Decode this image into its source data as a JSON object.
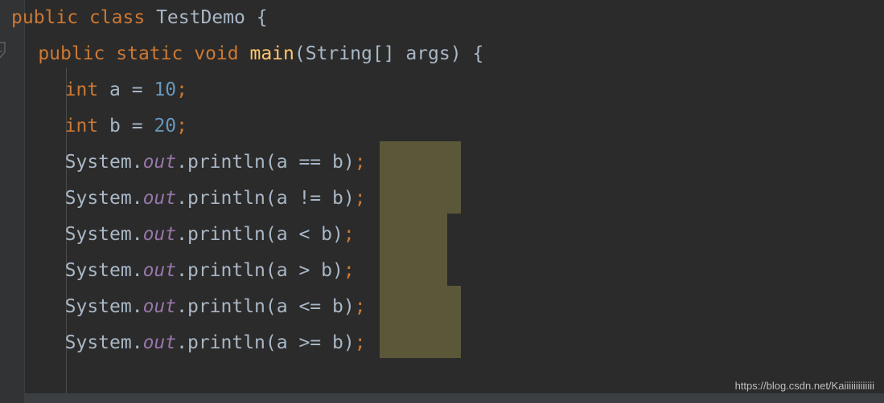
{
  "editor": {
    "theme_name": "darcula",
    "background_color": "#2b2b2b",
    "gutter_color": "#313335",
    "selection_color": "#5b5739",
    "default_text_color": "#a9b7c6",
    "keyword_color": "#cc7832",
    "number_color": "#6897bb",
    "method_color": "#ffc66d",
    "static_field_color": "#9876aa",
    "fold_marker": "code-fold-collapse-arrow"
  },
  "code": {
    "language": "Java",
    "class_name": "TestDemo",
    "lines": [
      {
        "indent": 0,
        "text": "public class TestDemo {",
        "tokens": [
          {
            "t": "public",
            "c": "kw"
          },
          {
            "t": " ",
            "c": "punc"
          },
          {
            "t": "class",
            "c": "kw"
          },
          {
            "t": " ",
            "c": "punc"
          },
          {
            "t": "TestDemo",
            "c": "typ"
          },
          {
            "t": " {",
            "c": "punc"
          }
        ]
      },
      {
        "indent": 1,
        "text": "public static void main(String[] args) {",
        "tokens": [
          {
            "t": "public",
            "c": "kw"
          },
          {
            "t": " ",
            "c": "punc"
          },
          {
            "t": "static",
            "c": "kw"
          },
          {
            "t": " ",
            "c": "punc"
          },
          {
            "t": "void",
            "c": "kw"
          },
          {
            "t": " ",
            "c": "punc"
          },
          {
            "t": "main",
            "c": "fn"
          },
          {
            "t": "(",
            "c": "punc"
          },
          {
            "t": "String",
            "c": "typ"
          },
          {
            "t": "[] ",
            "c": "punc"
          },
          {
            "t": "args",
            "c": "id"
          },
          {
            "t": ") {",
            "c": "punc"
          }
        ]
      },
      {
        "indent": 2,
        "text": "int a = 10;",
        "tokens": [
          {
            "t": "int",
            "c": "kw"
          },
          {
            "t": " ",
            "c": "punc"
          },
          {
            "t": "a",
            "c": "id"
          },
          {
            "t": " = ",
            "c": "punc"
          },
          {
            "t": "10",
            "c": "num"
          },
          {
            "t": ";",
            "c": "semi"
          }
        ]
      },
      {
        "indent": 2,
        "text": "int b = 20;",
        "tokens": [
          {
            "t": "int",
            "c": "kw"
          },
          {
            "t": " ",
            "c": "punc"
          },
          {
            "t": "b",
            "c": "id"
          },
          {
            "t": " = ",
            "c": "punc"
          },
          {
            "t": "20",
            "c": "num"
          },
          {
            "t": ";",
            "c": "semi"
          }
        ]
      },
      {
        "indent": 2,
        "text": "System.out.println(a == b);",
        "selection": "a == b",
        "tokens": [
          {
            "t": "System",
            "c": "typ"
          },
          {
            "t": ".",
            "c": "punc"
          },
          {
            "t": "out",
            "c": "stat"
          },
          {
            "t": ".println(",
            "c": "punc"
          },
          {
            "t": "a",
            "c": "id"
          },
          {
            "t": " == ",
            "c": "punc"
          },
          {
            "t": "b",
            "c": "id"
          },
          {
            "t": ")",
            "c": "punc"
          },
          {
            "t": ";",
            "c": "semi"
          }
        ]
      },
      {
        "indent": 2,
        "text": "System.out.println(a != b);",
        "selection": "a != b",
        "tokens": [
          {
            "t": "System",
            "c": "typ"
          },
          {
            "t": ".",
            "c": "punc"
          },
          {
            "t": "out",
            "c": "stat"
          },
          {
            "t": ".println(",
            "c": "punc"
          },
          {
            "t": "a",
            "c": "id"
          },
          {
            "t": " != ",
            "c": "punc"
          },
          {
            "t": "b",
            "c": "id"
          },
          {
            "t": ")",
            "c": "punc"
          },
          {
            "t": ";",
            "c": "semi"
          }
        ]
      },
      {
        "indent": 2,
        "text": "System.out.println(a < b);",
        "selection": "a < b",
        "tokens": [
          {
            "t": "System",
            "c": "typ"
          },
          {
            "t": ".",
            "c": "punc"
          },
          {
            "t": "out",
            "c": "stat"
          },
          {
            "t": ".println(",
            "c": "punc"
          },
          {
            "t": "a",
            "c": "id"
          },
          {
            "t": " < ",
            "c": "punc"
          },
          {
            "t": "b",
            "c": "id"
          },
          {
            "t": ")",
            "c": "punc"
          },
          {
            "t": ";",
            "c": "semi"
          }
        ]
      },
      {
        "indent": 2,
        "text": "System.out.println(a > b);",
        "selection": "a > b",
        "tokens": [
          {
            "t": "System",
            "c": "typ"
          },
          {
            "t": ".",
            "c": "punc"
          },
          {
            "t": "out",
            "c": "stat"
          },
          {
            "t": ".println(",
            "c": "punc"
          },
          {
            "t": "a",
            "c": "id"
          },
          {
            "t": " > ",
            "c": "punc"
          },
          {
            "t": "b",
            "c": "id"
          },
          {
            "t": ")",
            "c": "punc"
          },
          {
            "t": ";",
            "c": "semi"
          }
        ]
      },
      {
        "indent": 2,
        "text": "System.out.println(a <= b);",
        "selection": "a <= b",
        "tokens": [
          {
            "t": "System",
            "c": "typ"
          },
          {
            "t": ".",
            "c": "punc"
          },
          {
            "t": "out",
            "c": "stat"
          },
          {
            "t": ".println(",
            "c": "punc"
          },
          {
            "t": "a",
            "c": "id"
          },
          {
            "t": " <= ",
            "c": "punc"
          },
          {
            "t": "b",
            "c": "id"
          },
          {
            "t": ")",
            "c": "punc"
          },
          {
            "t": ";",
            "c": "semi"
          }
        ]
      },
      {
        "indent": 2,
        "text": "System.out.println(a >= b);",
        "selection": "a >= b",
        "tokens": [
          {
            "t": "System",
            "c": "typ"
          },
          {
            "t": ".",
            "c": "punc"
          },
          {
            "t": "out",
            "c": "stat"
          },
          {
            "t": ".println(",
            "c": "punc"
          },
          {
            "t": "a",
            "c": "id"
          },
          {
            "t": " >= ",
            "c": "punc"
          },
          {
            "t": "b",
            "c": "id"
          },
          {
            "t": ")",
            "c": "punc"
          },
          {
            "t": ";",
            "c": "semi"
          }
        ]
      }
    ]
  },
  "watermark": {
    "text": "https://blog.csdn.net/Kaiiiiiiiiiiiii"
  }
}
